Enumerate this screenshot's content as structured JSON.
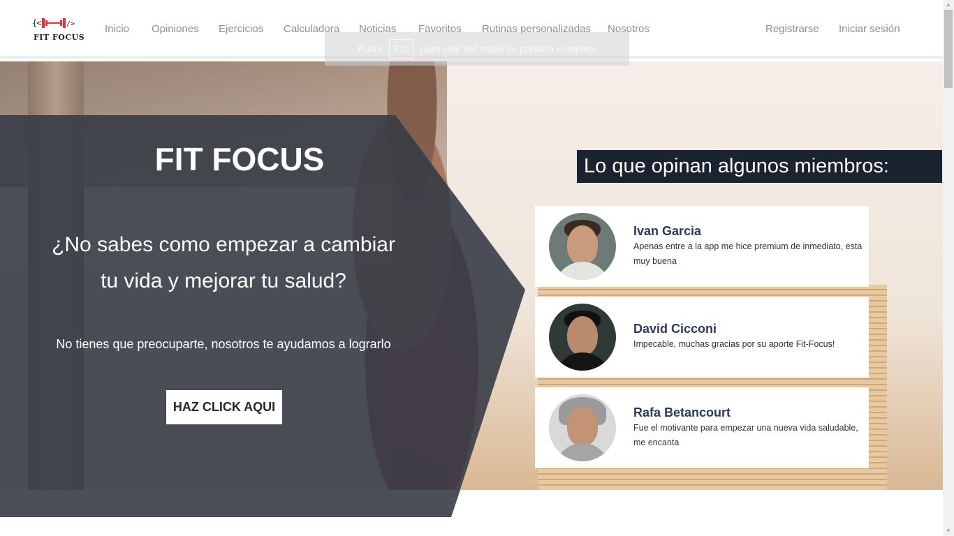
{
  "brand": {
    "name": "FIT FOCUS",
    "accent_color": "#e3303c",
    "icon": "dumbbell-icon"
  },
  "nav": {
    "items": [
      {
        "label": "Inicio"
      },
      {
        "label": "Opiniones"
      },
      {
        "label": "Ejercicios"
      },
      {
        "label": "Calculadora"
      },
      {
        "label": "Noticias"
      },
      {
        "label": "Favoritos"
      },
      {
        "label": "Rutinas personalizadas"
      },
      {
        "label": "Nosotros"
      }
    ],
    "auth": {
      "register": "Registrarse",
      "login": "Iniciar sesión"
    }
  },
  "fullscreen_notice": {
    "before": "Pulsa",
    "key": "F11",
    "after": "para salir del modo de pantalla completa"
  },
  "hero": {
    "title": "FIT FOCUS",
    "question_line1": "¿No sabes como empezar a cambiar",
    "question_line2": "tu vida y mejorar tu salud?",
    "subtitle": "No tienes que preocuparte, nosotros te ayudamos a lograrlo",
    "cta": "HAZ CLICK AQUI"
  },
  "testimonials": {
    "heading": "Lo que opinan algunos miembros:",
    "items": [
      {
        "name": "Ivan Garcia",
        "quote": "Apenas entre a la app me hice premium de inmediato, esta muy buena"
      },
      {
        "name": "David Cicconi",
        "quote": "Impecable, muchas gracias por su aporte Fit-Focus!"
      },
      {
        "name": "Rafa Betancourt",
        "quote": "Fue el motivante para empezar una nueva vida saludable, me encanta"
      }
    ]
  },
  "colors": {
    "panel_dark": "#373c46",
    "heading_bg": "#1b2230",
    "name_color": "#2d3a5a",
    "nav_text": "#8a8f99"
  }
}
